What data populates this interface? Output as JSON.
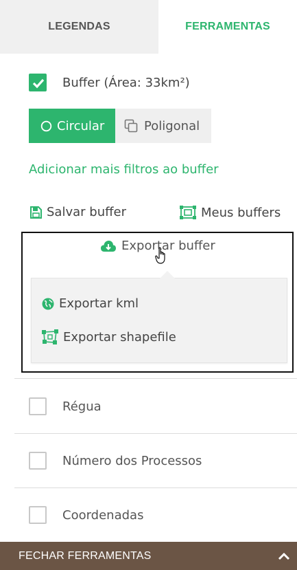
{
  "tabs": [
    {
      "label": "LEGENDAS",
      "active": false
    },
    {
      "label": "FERRAMENTAS",
      "active": true
    }
  ],
  "buffer": {
    "checked": true,
    "label": "Buffer (Área: 33km²)",
    "modes": [
      {
        "label": "Circular",
        "icon": "circle-outline-icon",
        "selected": true
      },
      {
        "label": "Poligonal",
        "icon": "copy-polygon-icon",
        "selected": false
      }
    ],
    "add_filters_link": "Adicionar mais filtros ao buffer",
    "save_label": "Salvar buffer",
    "my_buffers_label": "Meus buffers",
    "export_label": "Exportar buffer",
    "export_options": [
      {
        "label": "Exportar kml",
        "icon": "globe-icon"
      },
      {
        "label": "Exportar shapefile",
        "icon": "shape-nodes-icon"
      }
    ]
  },
  "tools": [
    {
      "label": "Régua",
      "checked": false
    },
    {
      "label": "Número dos Processos",
      "checked": false
    },
    {
      "label": "Coordenadas",
      "checked": false
    }
  ],
  "footer": {
    "label": "FECHAR FERRAMENTAS",
    "icon": "chevron-up-icon"
  },
  "colors": {
    "accent": "#2db56e",
    "footer_bg": "#6b5545",
    "tab_inactive_bg": "#f0f0f0"
  }
}
